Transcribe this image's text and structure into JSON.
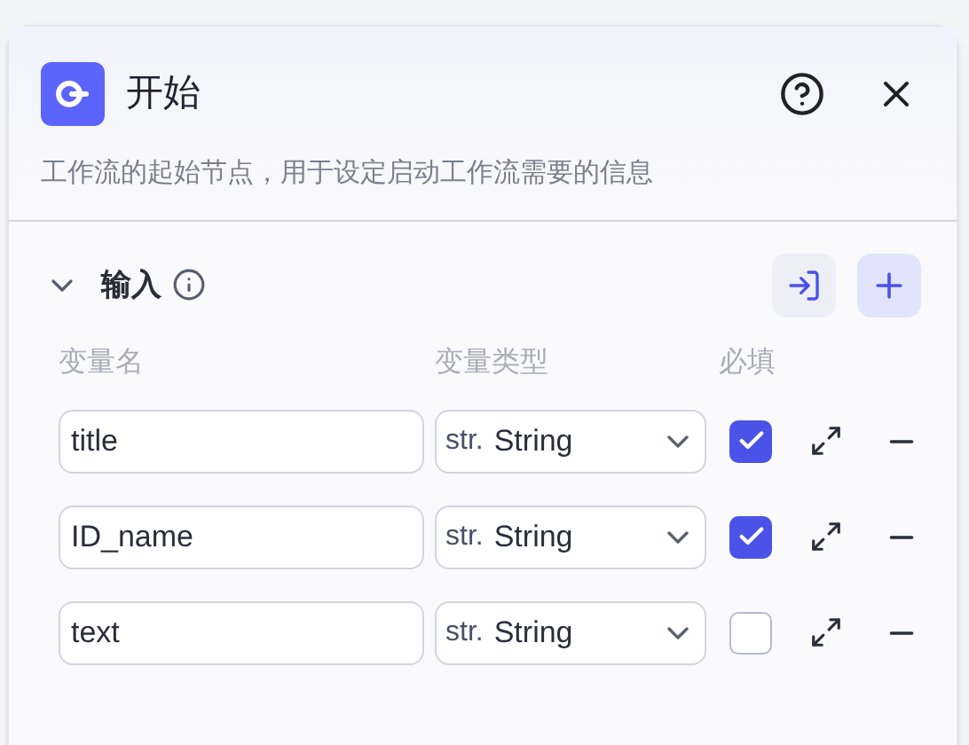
{
  "header": {
    "title": "开始",
    "description": "工作流的起始节点，用于设定启动工作流需要的信息"
  },
  "section": {
    "title": "输入",
    "expanded": true
  },
  "columns": [
    "变量名",
    "变量类型",
    "必填"
  ],
  "variables": [
    {
      "name": "title",
      "type_prefix": "str.",
      "type": "String",
      "required": true
    },
    {
      "name": "ID_name",
      "type_prefix": "str.",
      "type": "String",
      "required": true
    },
    {
      "name": "text",
      "type_prefix": "str.",
      "type": "String",
      "required": false
    }
  ]
}
